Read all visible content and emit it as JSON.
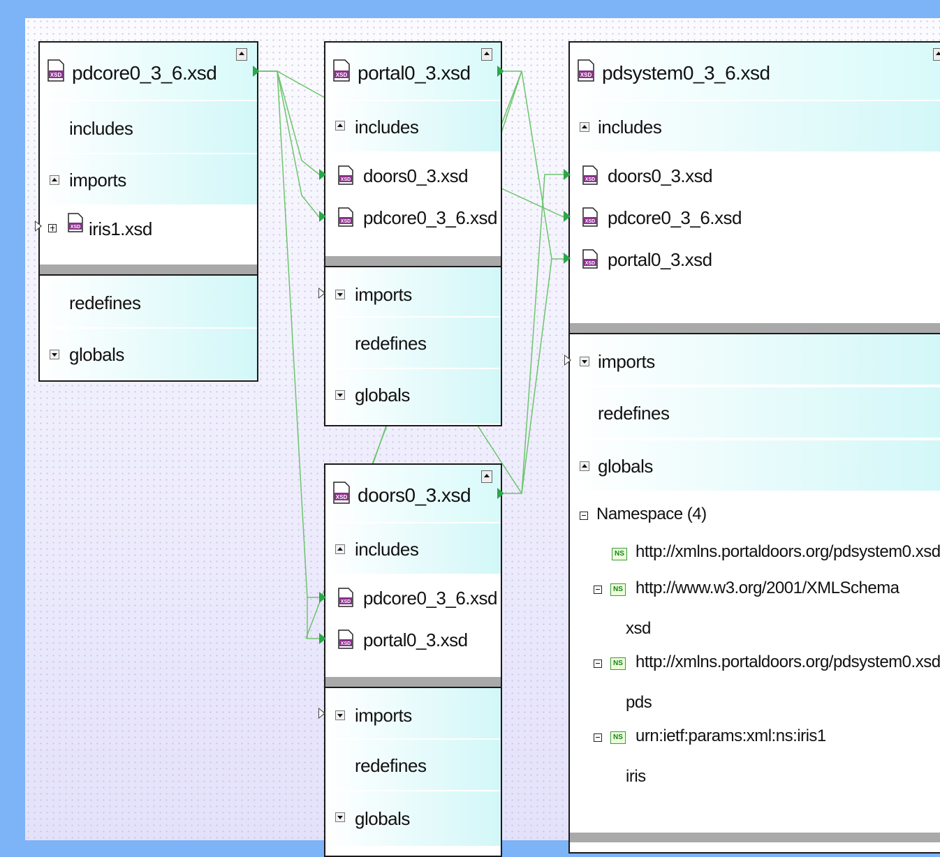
{
  "boxes": {
    "pdcore": {
      "title": "pdcore0_3_6.xsd",
      "includes": "includes",
      "imports": "imports",
      "imports_items": [
        "iris1.xsd"
      ],
      "redefines": "redefines",
      "globals": "globals"
    },
    "portal": {
      "title": "portal0_3.xsd",
      "includes": "includes",
      "includes_items": [
        "doors0_3.xsd",
        "pdcore0_3_6.xsd"
      ],
      "imports": "imports",
      "redefines": "redefines",
      "globals": "globals"
    },
    "doors": {
      "title": "doors0_3.xsd",
      "includes": "includes",
      "includes_items": [
        "pdcore0_3_6.xsd",
        "portal0_3.xsd"
      ],
      "imports": "imports",
      "redefines": "redefines",
      "globals": "globals"
    },
    "pdsystem": {
      "title": "pdsystem0_3_6.xsd",
      "includes": "includes",
      "includes_items": [
        "doors0_3.xsd",
        "pdcore0_3_6.xsd",
        "portal0_3.xsd"
      ],
      "imports": "imports",
      "redefines": "redefines",
      "globals": "globals",
      "namespace_header": "Namespace (4)",
      "namespaces": [
        {
          "uri": "http://xmlns.portaldoors.org/pdsystem0.xsd",
          "prefix": ""
        },
        {
          "uri": "http://www.w3.org/2001/XMLSchema",
          "prefix": "xsd"
        },
        {
          "uri": "http://xmlns.portaldoors.org/pdsystem0.xsd",
          "prefix": "pds"
        },
        {
          "uri": "urn:ietf:params:xml:ns:iris1",
          "prefix": "iris"
        }
      ]
    }
  },
  "icons": {
    "file": "xsd-file-icon",
    "namespace": "namespace-icon",
    "link": "include-link-arrow-icon"
  },
  "colors": {
    "background": "#7db3f7",
    "canvas": "#f5f3fd",
    "band": "#d2f7f8",
    "wire": "#2aa84a",
    "border": "#1a1a1a",
    "separator": "#a9a9a9"
  }
}
